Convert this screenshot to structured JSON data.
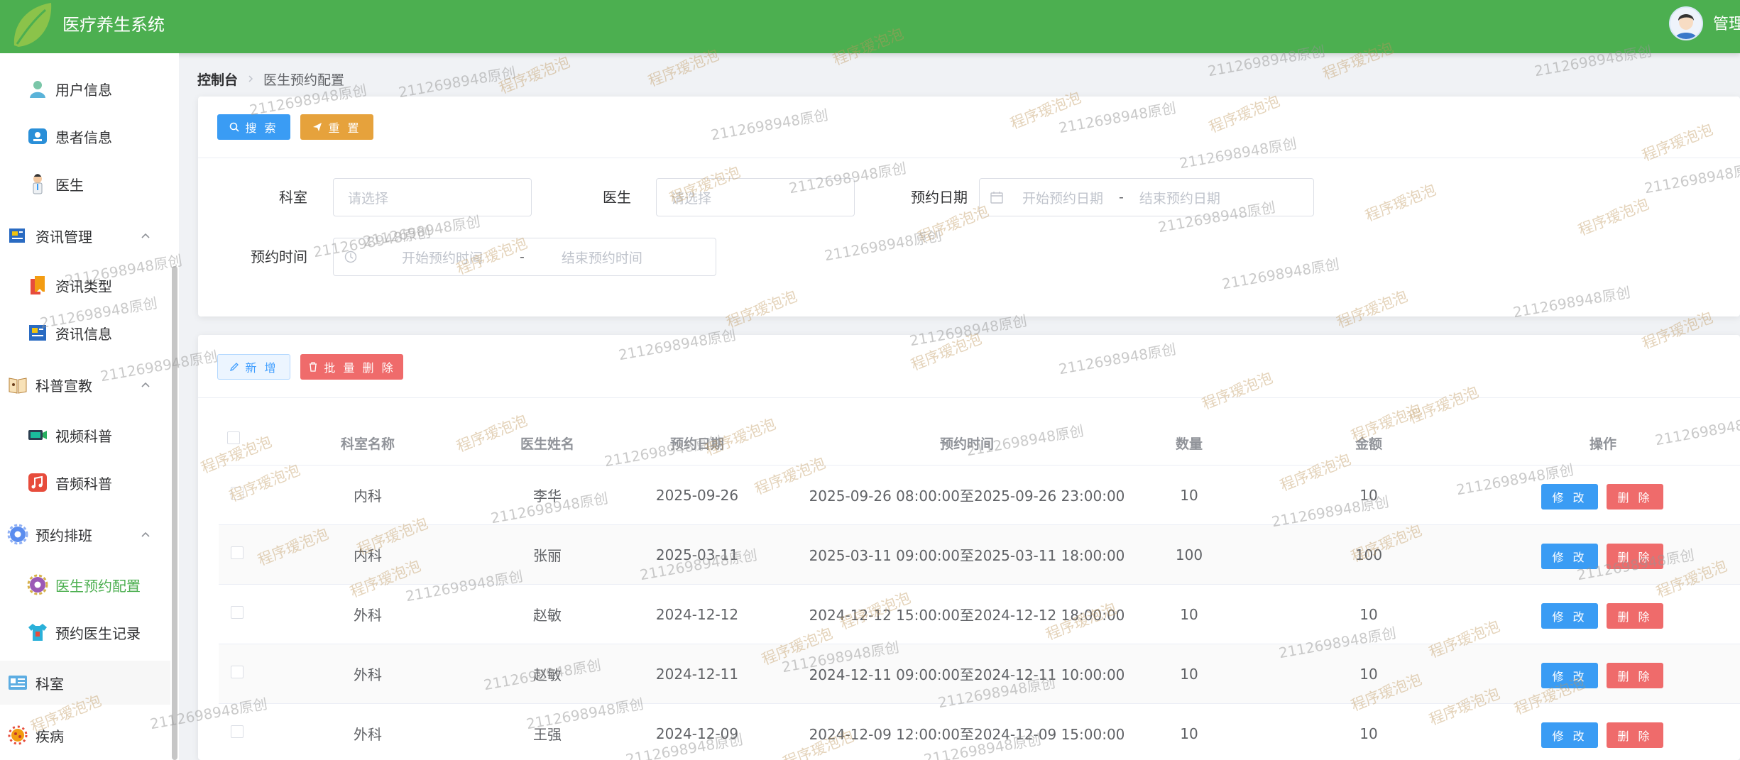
{
  "header": {
    "title": "医疗养生系统",
    "user_label": "管理"
  },
  "sidebar": {
    "items": [
      {
        "label": "用户信息",
        "icon": "user-icon"
      },
      {
        "label": "患者信息",
        "icon": "id-card-icon"
      },
      {
        "label": "医生",
        "icon": "doctor-icon"
      },
      {
        "label": "资讯管理",
        "icon": "newspaper-icon"
      },
      {
        "label": "资讯类型",
        "icon": "bookmark-icon"
      },
      {
        "label": "资讯信息",
        "icon": "news-icon"
      },
      {
        "label": "科普宣教",
        "icon": "book-icon"
      },
      {
        "label": "视频科普",
        "icon": "video-icon"
      },
      {
        "label": "音频科普",
        "icon": "music-icon"
      },
      {
        "label": "预约排班",
        "icon": "gear-icon"
      },
      {
        "label": "医生预约配置",
        "icon": "gear-icon"
      },
      {
        "label": "预约医生记录",
        "icon": "shirt-icon"
      },
      {
        "label": "科室",
        "icon": "department-icon"
      },
      {
        "label": "疾病",
        "icon": "virus-icon"
      }
    ]
  },
  "breadcrumb": {
    "home": "控制台",
    "current": "医生预约配置"
  },
  "search": {
    "search_label": "搜 索",
    "reset_label": "重 置",
    "department_label": "科室",
    "department_placeholder": "请选择",
    "doctor_label": "医生",
    "doctor_placeholder": "请选择",
    "date_label": "预约日期",
    "date_start_placeholder": "开始预约日期",
    "date_end_placeholder": "结束预约日期",
    "time_label": "预约时间",
    "time_start_placeholder": "开始预约时间",
    "time_end_placeholder": "结束预约时间",
    "range_separator": "-"
  },
  "toolbar": {
    "add_label": "新 增",
    "batch_delete_label": "批 量 删 除"
  },
  "table": {
    "columns": [
      "科室名称",
      "医生姓名",
      "预约日期",
      "预约时间",
      "数量",
      "金额",
      "操作"
    ],
    "edit_label": "修 改",
    "delete_label": "删 除",
    "rows": [
      {
        "department": "内科",
        "doctor": "李华",
        "date": "2025-09-26",
        "time": "2025-09-26 08:00:00至2025-09-26 23:00:00",
        "count": "10",
        "amount": "10"
      },
      {
        "department": "内科",
        "doctor": "张丽",
        "date": "2025-03-11",
        "time": "2025-03-11 09:00:00至2025-03-11 18:00:00",
        "count": "100",
        "amount": "100"
      },
      {
        "department": "外科",
        "doctor": "赵敏",
        "date": "2024-12-12",
        "time": "2024-12-12 15:00:00至2024-12-12 18:00:00",
        "count": "10",
        "amount": "10"
      },
      {
        "department": "外科",
        "doctor": "赵敏",
        "date": "2024-12-11",
        "time": "2024-12-11 09:00:00至2024-12-11 10:00:00",
        "count": "10",
        "amount": "10"
      },
      {
        "department": "外科",
        "doctor": "王强",
        "date": "2024-12-09",
        "time": "2024-12-09 12:00:00至2024-12-09 15:00:00",
        "count": "10",
        "amount": "10"
      }
    ]
  },
  "watermark": {
    "text_a": "程序瑷泡泡",
    "text_b": "2112698948原创"
  },
  "colors": {
    "header": "#4caf50",
    "primary": "#3a9cf4",
    "warning": "#e6a23c",
    "danger": "#ef6b6b",
    "active": "#4caf50"
  }
}
